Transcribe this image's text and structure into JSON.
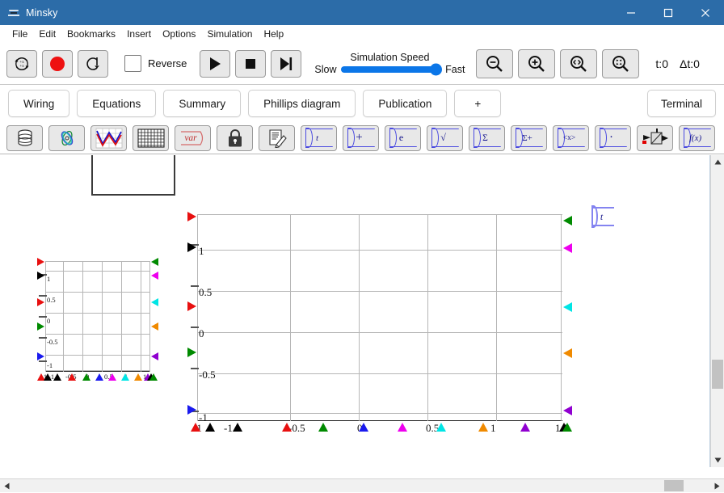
{
  "window": {
    "title": "Minsky",
    "icon": "minsky-logo-icon",
    "controls": {
      "minimize": "minimize-icon",
      "maximize": "maximize-icon",
      "close": "close-icon"
    }
  },
  "menubar": {
    "items": [
      {
        "label": "File"
      },
      {
        "label": "Edit"
      },
      {
        "label": "Bookmarks"
      },
      {
        "label": "Insert"
      },
      {
        "label": "Options"
      },
      {
        "label": "Simulation"
      },
      {
        "label": "Help"
      }
    ]
  },
  "simulation_toolbar": {
    "buttons": [
      {
        "name": "reset-button",
        "icon": "reset-circular-arrows-icon"
      },
      {
        "name": "record-button",
        "icon": "record-red-circle-icon"
      },
      {
        "name": "replay-button",
        "icon": "replay-loop-arrow-icon"
      }
    ],
    "reverse": {
      "label": "Reverse",
      "checked": false
    },
    "transport": [
      {
        "name": "play-button",
        "icon": "play-triangle-icon"
      },
      {
        "name": "stop-button",
        "icon": "stop-square-icon"
      },
      {
        "name": "step-button",
        "icon": "step-forward-icon"
      }
    ],
    "speed": {
      "title": "Simulation Speed",
      "min_label": "Slow",
      "max_label": "Fast",
      "value": 100
    },
    "zoom_buttons": [
      {
        "name": "zoom-out-button",
        "icon": "magnifier-minus-icon"
      },
      {
        "name": "zoom-in-button",
        "icon": "magnifier-plus-icon"
      },
      {
        "name": "zoom-fit-button",
        "icon": "magnifier-fit-icon"
      },
      {
        "name": "zoom-reset-button",
        "icon": "magnifier-reset-icon"
      }
    ],
    "status": {
      "time": "t:0",
      "delta_time": "Δt:0"
    }
  },
  "tabs": {
    "items": [
      {
        "label": "Wiring",
        "selected": false
      },
      {
        "label": "Equations",
        "selected": false
      },
      {
        "label": "Summary",
        "selected": false
      },
      {
        "label": "Phillips diagram",
        "selected": false
      },
      {
        "label": "Publication",
        "selected": false
      },
      {
        "label": "+",
        "selected": false
      }
    ],
    "terminal": {
      "label": "Terminal"
    }
  },
  "palette": {
    "items": [
      {
        "name": "godley-table-button",
        "icon": "database-cylinder-icon",
        "label": ""
      },
      {
        "name": "ravel-button",
        "icon": "ravel-loops-icon",
        "label": ""
      },
      {
        "name": "plot-widget-button",
        "icon": "plot-curves-icon",
        "label": ""
      },
      {
        "name": "sheet-button",
        "icon": "grid-sheet-icon",
        "label": ""
      },
      {
        "name": "variable-button",
        "icon": "var-italic-icon",
        "label": "var"
      },
      {
        "name": "lock-button",
        "icon": "padlock-icon",
        "label": ""
      },
      {
        "name": "note-button",
        "icon": "note-pencil-icon",
        "label": ""
      },
      {
        "name": "time-op-button",
        "icon": "operation-icon",
        "label": "t"
      },
      {
        "name": "add-op-button",
        "icon": "operation-icon",
        "label": "+"
      },
      {
        "name": "exp-op-button",
        "icon": "operation-icon",
        "label": "e"
      },
      {
        "name": "sqrt-op-button",
        "icon": "operation-icon",
        "label": "√"
      },
      {
        "name": "sum-op-button",
        "icon": "operation-icon",
        "label": "Σ"
      },
      {
        "name": "runningsum-op-button",
        "icon": "operation-icon",
        "label": "Σ+"
      },
      {
        "name": "mean-op-button",
        "icon": "operation-icon",
        "label": "<x>"
      },
      {
        "name": "dot-op-button",
        "icon": "operation-icon",
        "label": "·"
      },
      {
        "name": "integrate-button",
        "icon": "integral-flow-icon",
        "label": ""
      },
      {
        "name": "userfunction-button",
        "icon": "fx-icon",
        "label": "f(x)"
      }
    ]
  },
  "canvas": {
    "godley_fragment": {
      "name": "godley-icon-fragment"
    },
    "time_variable": {
      "label": "t"
    },
    "plots": [
      {
        "name": "plot-widget-small",
        "x_ticks": [
          "-1",
          "-1",
          "-0.5",
          "0",
          "0.5",
          "1",
          "1"
        ],
        "y_ticks": [
          "1",
          "0.5",
          "0",
          "-0.5",
          "-1"
        ],
        "left_ports": [
          "#e81010",
          "#000000",
          "#e81010",
          "#008a00",
          "#1a1aee"
        ],
        "right_ports": [
          "#008a00",
          "#ee00ee",
          "#00e5e5",
          "#f08a00",
          "#9000d0"
        ],
        "bottom_ports": [
          "#e81010",
          "#000000",
          "#000000",
          "#e81010",
          "#008a00",
          "#1a1aee",
          "#ee00ee",
          "#00e5e5",
          "#f08a00",
          "#9000d0",
          "#000000",
          "#008a00"
        ]
      },
      {
        "name": "plot-widget-large",
        "x_ticks": [
          "-1",
          "-1",
          "-0.5",
          "0",
          "0.5",
          "1",
          "1.5"
        ],
        "y_ticks": [
          "1",
          "0.5",
          "0",
          "-0.5",
          "-1"
        ],
        "left_ports": [
          "#e81010",
          "#000000",
          "#e81010",
          "#008a00",
          "#1a1aee"
        ],
        "right_ports": [
          "#008a00",
          "#ee00ee",
          "#00e5e5",
          "#f08a00",
          "#9000d0"
        ],
        "bottom_ports": [
          "#e81010",
          "#000000",
          "#000000",
          "#e81010",
          "#008a00",
          "#1a1aee",
          "#ee00ee",
          "#00e5e5",
          "#f08a00",
          "#9000d0",
          "#000000",
          "#008a00"
        ]
      }
    ]
  },
  "scrollbars": {
    "vertical": {
      "name": "vertical-scrollbar"
    },
    "horizontal": {
      "name": "horizontal-scrollbar"
    }
  },
  "colors": {
    "titlebar": "#2c6ca8",
    "accent_blue": "#0b76e8",
    "button_face": "#e8e8e8",
    "record_red": "#ee1111"
  }
}
